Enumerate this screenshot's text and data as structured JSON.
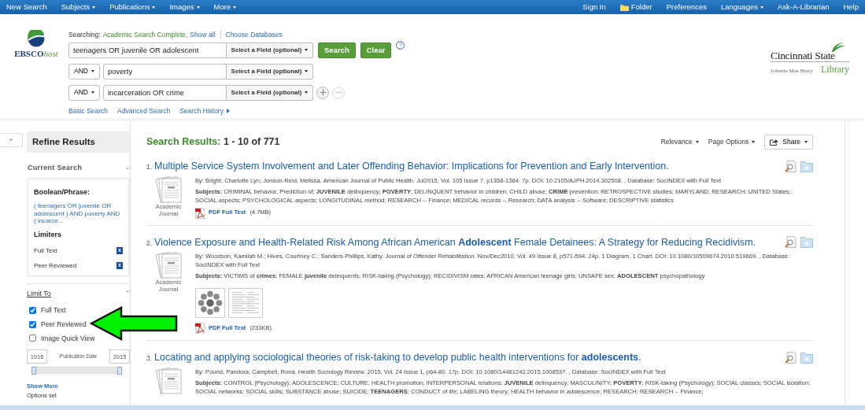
{
  "top_nav": {
    "left": [
      {
        "label": "New Search",
        "dropdown": false
      },
      {
        "label": "Subjects",
        "dropdown": true
      },
      {
        "label": "Publications",
        "dropdown": true
      },
      {
        "label": "Images",
        "dropdown": true
      },
      {
        "label": "More",
        "dropdown": true
      }
    ],
    "right": [
      {
        "label": "Sign In",
        "dropdown": false,
        "kind": "link"
      },
      {
        "label": "Folder",
        "dropdown": false,
        "kind": "folder"
      },
      {
        "label": "Preferences",
        "dropdown": false,
        "kind": "link"
      },
      {
        "label": "Languages",
        "dropdown": true,
        "kind": "link"
      },
      {
        "label": "Ask-A-Librarian",
        "dropdown": false,
        "kind": "link"
      },
      {
        "label": "Help",
        "dropdown": false,
        "kind": "link"
      }
    ]
  },
  "logo": {
    "main": "EBSCO",
    "suffix": "host"
  },
  "library_logo": {
    "name": "Cincinnati State",
    "subtitle": "Johnnie Mae Berry",
    "library": "Library"
  },
  "search": {
    "searching_label": "Searching:",
    "database": "Academic Search Complete,",
    "show_all": "Show all",
    "choose_databases": "Choose Databases",
    "rows": [
      {
        "operator": null,
        "value": "teenagers OR juvenile OR adolescent",
        "field": "Select a Field (optional)"
      },
      {
        "operator": "AND",
        "value": "poverty",
        "field": "Select a Field (optional)"
      },
      {
        "operator": "AND",
        "value": "incarceration OR crime",
        "field": "Select a Field (optional)"
      }
    ],
    "search_button": "Search",
    "clear_button": "Clear",
    "help": "?",
    "remove_row_disabled": true,
    "links": [
      {
        "label": "Basic Search",
        "arrow": false
      },
      {
        "label": "Advanced Search",
        "arrow": false
      },
      {
        "label": "Search History",
        "arrow": true
      }
    ]
  },
  "sidebar": {
    "collapse": "«",
    "title": "Refine Results",
    "current_search": "Current Search",
    "boolean_label": "Boolean/Phrase:",
    "boolean_text": "( teenagers OR juvenile OR adolescent ) AND poverty AND ( incarce...",
    "limiters_label": "Limiters",
    "limiters": [
      {
        "label": "Full Text",
        "remove": "x"
      },
      {
        "label": "Peer Reviewed",
        "remove": "x"
      }
    ],
    "limit_to": "Limit To",
    "options": [
      {
        "label": "Full Text",
        "checked": true
      },
      {
        "label": "Peer Reviewed",
        "checked": true
      },
      {
        "label": "Image Quick View",
        "checked": false
      }
    ],
    "date": {
      "from": "1916",
      "label": "Publication Date",
      "to": "2015",
      "handles": [
        {
          "level": 0
        },
        {
          "level": 1
        }
      ]
    },
    "show_more": "Show More",
    "options_set": "Options set"
  },
  "results_header": {
    "label": "Search Results:",
    "range": "1 - 10 of 771",
    "sort": "Relevance",
    "page_options": "Page Options",
    "share": "Share"
  },
  "results": [
    {
      "number": "1.",
      "title": "Multiple Service System Involvement and Later Offending Behavior: Implications for Prevention and Early Intervention.",
      "byline": "By: Bright, Charlotte Lyn; Jonson-Reid, Melissa. American Journal of Public Health. Jul2015, Vol. 105 Issue 7, p1358-1364. 7p. DOI: 10.2105/AJPH.2014.302508. , Database: SocINDEX with Full Text",
      "subjects": "**Subjects:** CRIMINAL behavior, Prediction of; **JUVENILE** delinquency; **POVERTY**; DELINQUENT behavior in children; CHILD abuse; **CRIME** prevention; RETROSPECTIVE studies; MARYLAND; RESEARCH; UNITED States; SOCIAL aspects; PSYCHOLOGICAL aspects; LONGITUDINAL method; RESEARCH -- Finance; MEDICAL records -- Research; DATA analysis -- Software; DESCRIPTIVE statistics",
      "type": "Academic Journal",
      "pdf": "PDF Full Text",
      "size": "(4.7MB)"
    },
    {
      "number": "2.",
      "title": "Violence Exposure and Health-Related Risk Among African American **Adolescent** Female Detainees: A Strategy for Reducing Recidivism.",
      "byline": "By: Woodson, Kamilah M.; Hives, Courtney C.; Sanders-Phillips, Kathy. Journal of Offender Rehabilitation. Nov/Dec2010, Vol. 49 Issue 8, p571-594. 24p. 1 Diagram, 1 Chart. DOI: 10.1080/10509674.2010.519669. , Database: SocINDEX with Full Text",
      "subjects": "**Subjects:** VICTIMS of **crimes**; FEMALE **juvenile** delinquents; RISK-taking (Psychology); RECIDIVISM rates; AFRICAN American teenage girls; UNSAFE sex; **ADOLESCENT** psychopathology",
      "type": "Academic Journal",
      "thumbnails": [
        {
          "kind": "diagram"
        },
        {
          "kind": "chart"
        }
      ],
      "pdf": "PDF Full Text",
      "size": "(233KB)"
    },
    {
      "number": "3.",
      "title": "Locating and applying sociological theories of risk-taking to develop public health interventions for **adolescents**.",
      "byline": "By: Pound, Pandora; Campbell, Rona. Health Sociology Review. 2015, Vol. 24 Issue 1, p64-80. 17p. DOI: 10.1080/14461242.2015.1008537. , Database: SocINDEX with Full Text",
      "subjects": "**Subjects:** CONTROL (Psychology); ADOLESCENCE; CULTURE; HEALTH promotion; INTERPERSONAL relations; **JUVENILE** delinquency; MASCULINITY; **POVERTY**; RISK-taking (Psychology); SOCIAL classes; SOCIAL isolation; SOCIAL networks; SOCIAL skills; SUBSTANCE abuse; SUICIDE; **TEENAGERS**; CONDUCT of life; LABELING theory; HEALTH behavior in adolescence; RESEARCH; RESEARCH -- Finance;"
    }
  ]
}
